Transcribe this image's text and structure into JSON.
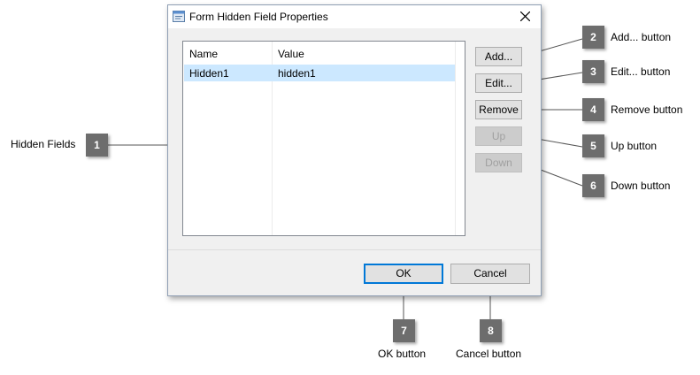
{
  "dialog": {
    "title": "Form Hidden Field Properties",
    "list": {
      "columns": [
        "Name",
        "Value"
      ],
      "rows": [
        {
          "name": "Hidden1",
          "value": "hidden1"
        }
      ]
    },
    "buttons": {
      "add": "Add...",
      "edit": "Edit...",
      "remove": "Remove",
      "up": "Up",
      "down": "Down",
      "ok": "OK",
      "cancel": "Cancel"
    }
  },
  "callouts": [
    {
      "number": "1",
      "label": "Hidden Fields"
    },
    {
      "number": "2",
      "label": "Add... button"
    },
    {
      "number": "3",
      "label": "Edit... button"
    },
    {
      "number": "4",
      "label": "Remove button"
    },
    {
      "number": "5",
      "label": "Up button"
    },
    {
      "number": "6",
      "label": "Down button"
    },
    {
      "number": "7",
      "label": "OK button"
    },
    {
      "number": "8",
      "label": "Cancel button"
    }
  ],
  "colors": {
    "selection": "#cce8ff",
    "callout": "#6d6d6d",
    "default_button_border": "#0078d7"
  }
}
